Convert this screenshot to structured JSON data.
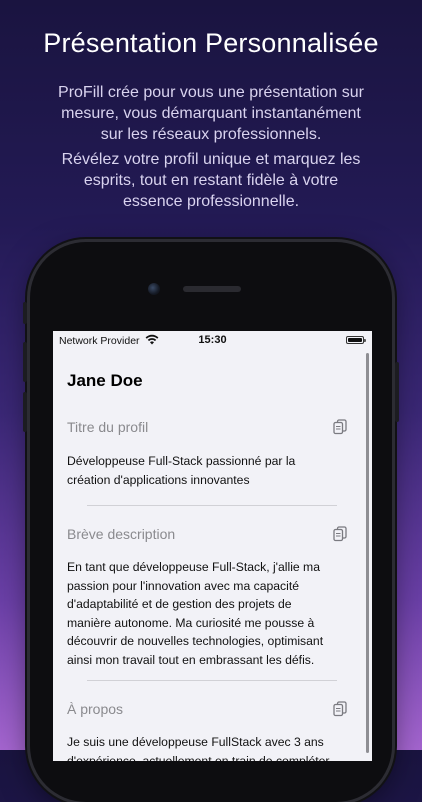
{
  "promo": {
    "title": "Présentation Personnalisée",
    "paragraph1": [
      "ProFill crée pour vous une présentation sur",
      "mesure, vous démarquant instantanément",
      "sur les réseaux professionnels."
    ],
    "paragraph2": [
      "Révélez votre profil unique et marquez les",
      "esprits, tout en restant fidèle à votre",
      "essence professionnelle."
    ]
  },
  "status_bar": {
    "carrier": "Network Provider",
    "time": "15:30"
  },
  "profile": {
    "name": "Jane Doe",
    "sections": [
      {
        "label": "Titre du profil",
        "lines": [
          "Développeuse Full-Stack passionné par la",
          "création d'applications innovantes"
        ]
      },
      {
        "label": "Brève description",
        "lines": [
          "En tant que développeuse Full-Stack, j'allie ma",
          "passion pour l'innovation avec ma capacité",
          "d'adaptabilité et de gestion des projets de",
          "manière autonome. Ma curiosité me pousse à",
          "découvrir de nouvelles technologies, optimisant",
          "ainsi mon travail tout en embrassant les défis."
        ]
      },
      {
        "label": "À propos",
        "lines": [
          "Je suis une développeuse FullStack avec 3 ans",
          "d'expérience, actuellement en train de compléter"
        ]
      }
    ]
  },
  "icons": {
    "copy": "copy-icon",
    "wifi": "wifi-icon",
    "battery": "battery-icon"
  }
}
